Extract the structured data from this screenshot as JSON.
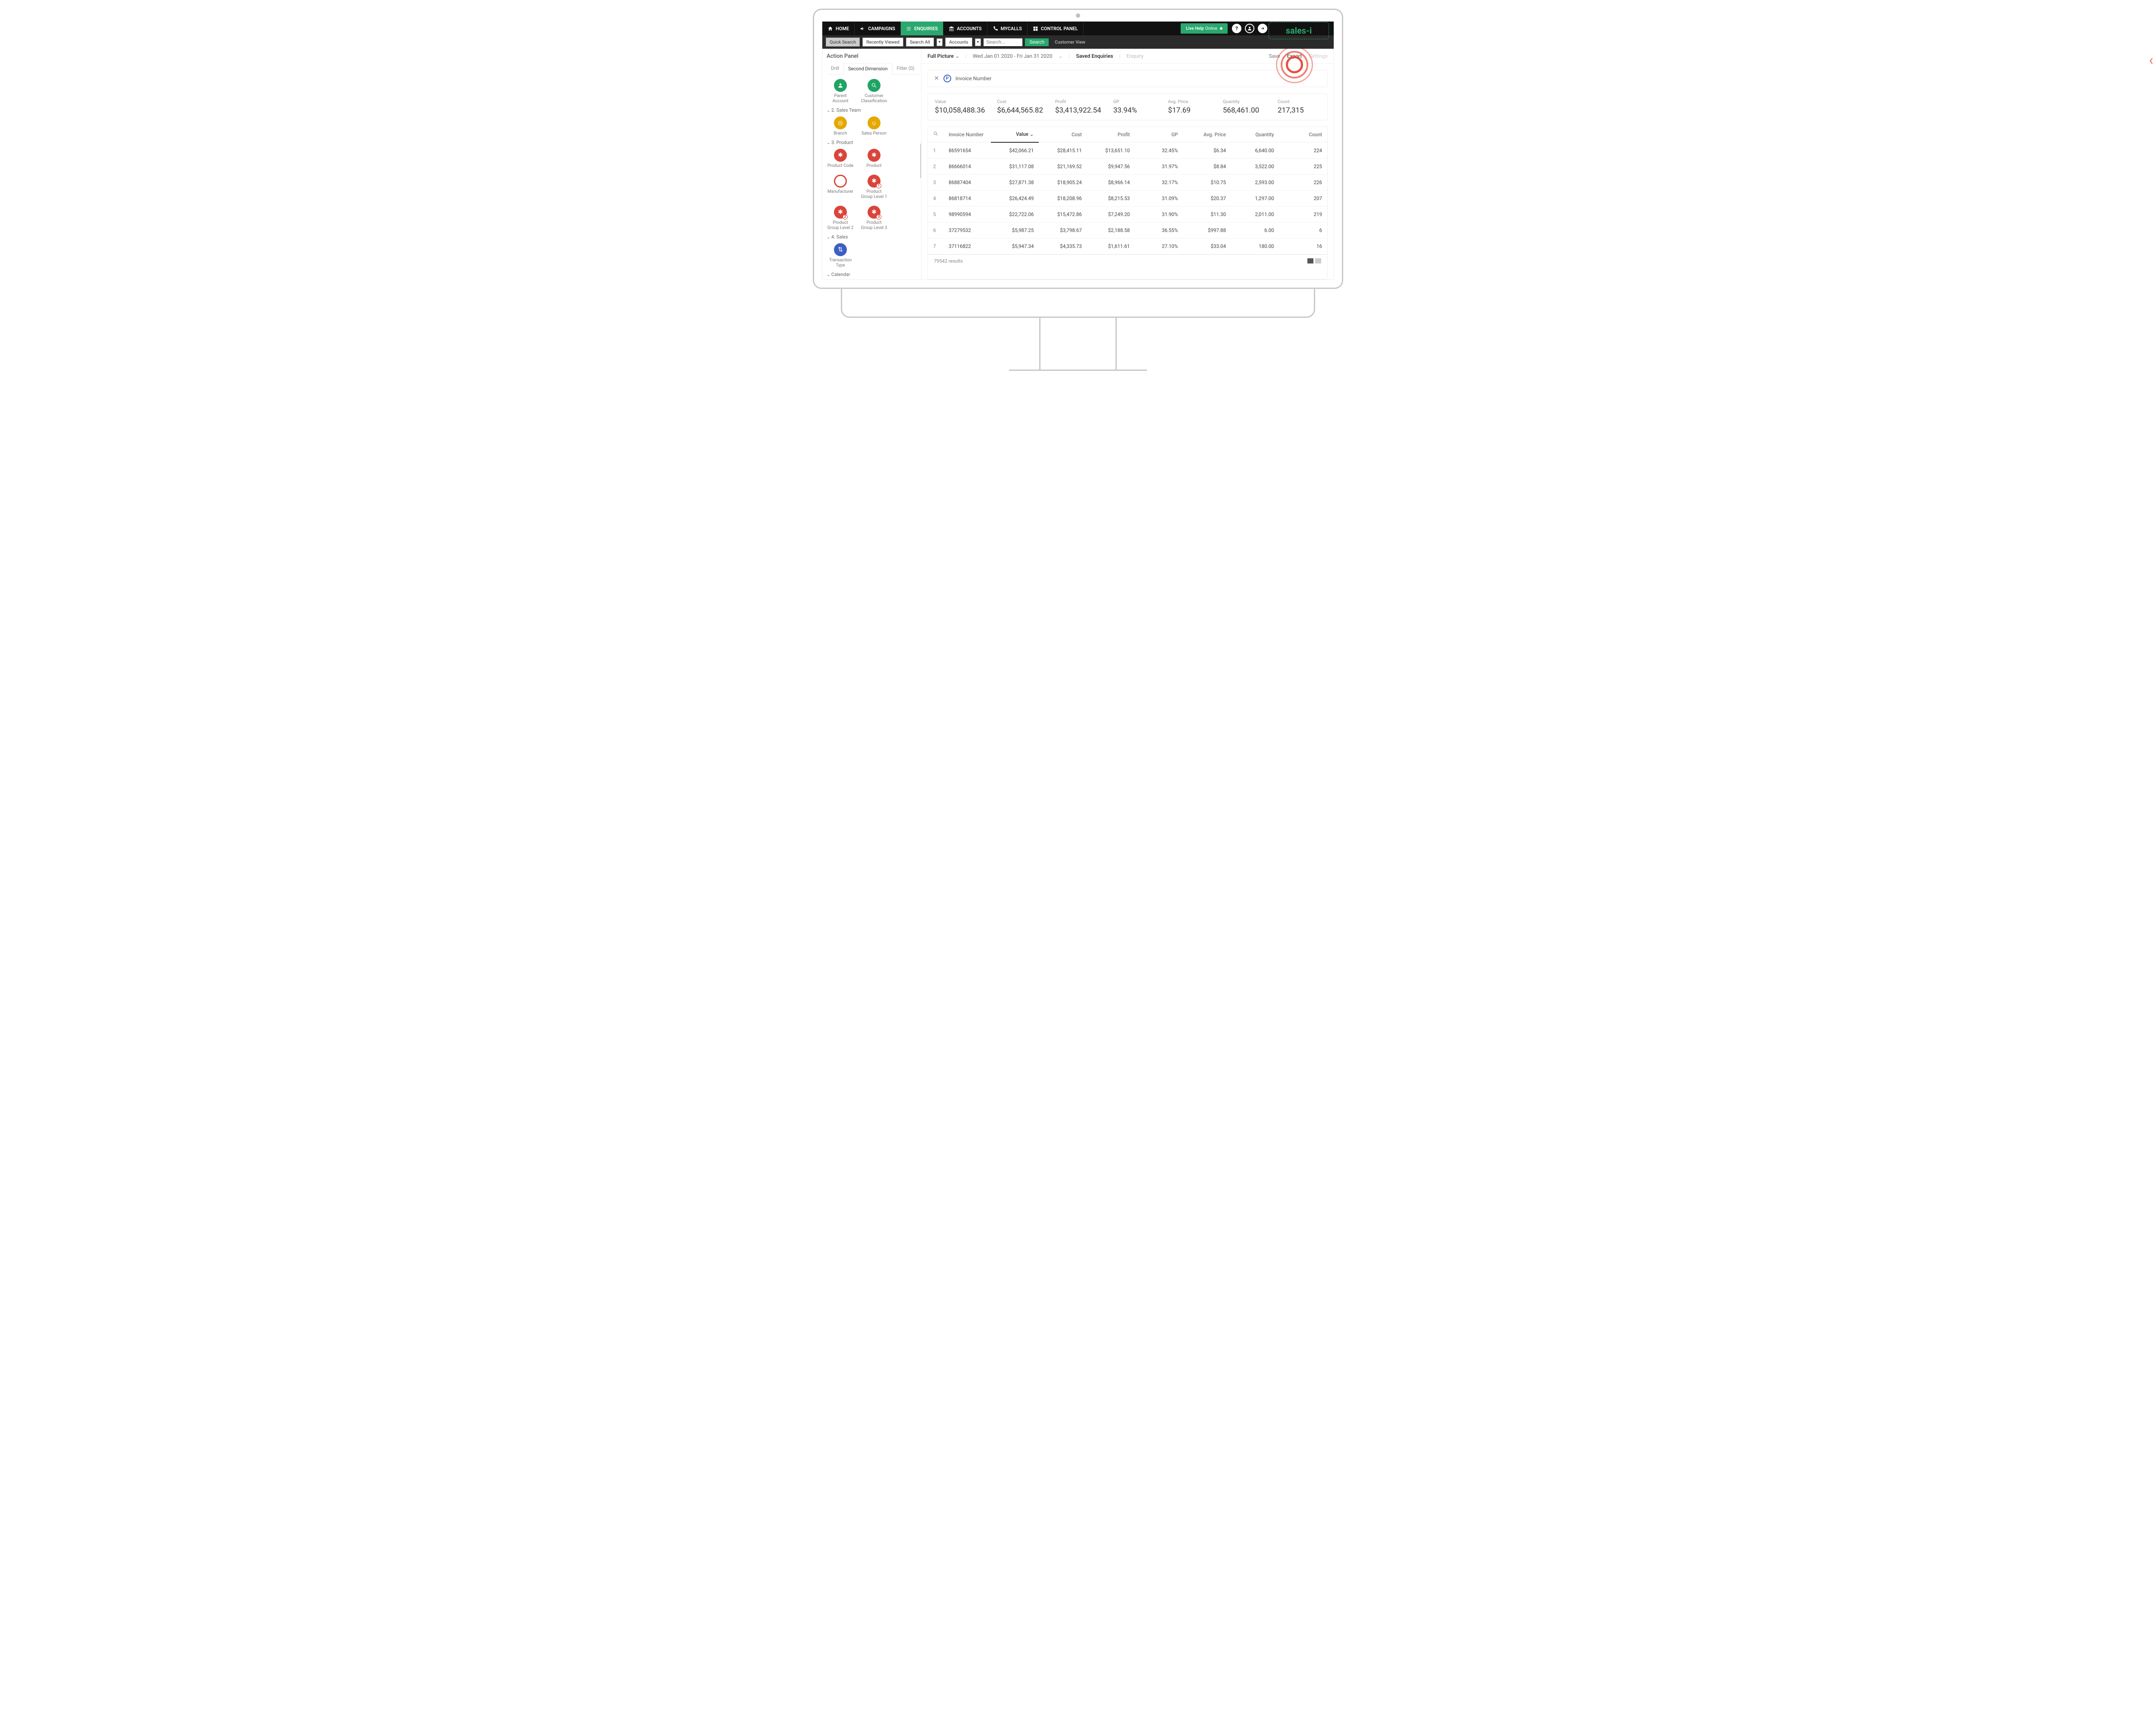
{
  "nav": {
    "home": "HOME",
    "campaigns": "CAMPAIGNS",
    "enquiries": "ENQUIRIES",
    "accounts": "ACCOUNTS",
    "mycalls": "MYCALLS",
    "control_panel": "CONTROL PANEL",
    "live_help": "Live Help",
    "online": "Online"
  },
  "logo": "sales-i",
  "search": {
    "quick": "Quick Search",
    "recent": "Recently Viewed",
    "search_all": "Search All",
    "accounts": "Accounts",
    "placeholder": "Search...",
    "go": "Search",
    "customer_view": "Customer View"
  },
  "sidebar": {
    "title": "Action Panel",
    "tabs": {
      "drill": "Drill",
      "second": "Second Dimension",
      "filter": "Filter (0)"
    },
    "top": {
      "parent_account": "Parent Account",
      "customer_class": "Customer Classification"
    },
    "g2": {
      "title": "2. Sales Team",
      "branch": "Branch",
      "sales_person": "Sales Person"
    },
    "g3": {
      "title": "3. Product",
      "product_code": "Product Code",
      "product": "Product",
      "manufacturer": "Manufacturer",
      "pg1": "Product Group Level 1",
      "pg2": "Product Group Level 2",
      "pg3": "Product Group Level 3"
    },
    "g4": {
      "title": "4. Sales",
      "transaction_type": "Transaction Type"
    },
    "g5": {
      "title": "Calendar"
    }
  },
  "crumbs": {
    "full_picture": "Full Picture",
    "date_range": "Wed Jan 01 2020 - Fri Jan 31 2020",
    "saved": "Saved Enquiries",
    "enquiry": "Enquiry",
    "save": "Save",
    "export": "Export",
    "settings": "Settings"
  },
  "chip": {
    "label": "Invoice Number"
  },
  "metrics": [
    {
      "k": "Value",
      "v": "$10,058,488.36"
    },
    {
      "k": "Cost",
      "v": "$6,644,565.82"
    },
    {
      "k": "Profit",
      "v": "$3,413,922.54"
    },
    {
      "k": "GP",
      "v": "33.94%"
    },
    {
      "k": "Avg. Price",
      "v": "$17.69"
    },
    {
      "k": "Quantity",
      "v": "568,461.00"
    },
    {
      "k": "Count",
      "v": "217,315"
    }
  ],
  "table": {
    "headers": {
      "invoice": "Invoice Number",
      "value": "Value",
      "cost": "Cost",
      "profit": "Profit",
      "gp": "GP",
      "avg": "Avg. Price",
      "qty": "Quantity",
      "count": "Count"
    },
    "rows": [
      {
        "n": "1",
        "inv": "86591654",
        "value": "$42,066.21",
        "cost": "$28,415.11",
        "profit": "$13,651.10",
        "gp": "32.45%",
        "avg": "$6.34",
        "qty": "6,640.00",
        "count": "224"
      },
      {
        "n": "2",
        "inv": "86666014",
        "value": "$31,117.08",
        "cost": "$21,169.52",
        "profit": "$9,947.56",
        "gp": "31.97%",
        "avg": "$8.84",
        "qty": "3,522.00",
        "count": "225"
      },
      {
        "n": "3",
        "inv": "86887404",
        "value": "$27,871.38",
        "cost": "$18,905.24",
        "profit": "$8,966.14",
        "gp": "32.17%",
        "avg": "$10.75",
        "qty": "2,593.00",
        "count": "226"
      },
      {
        "n": "4",
        "inv": "86818714",
        "value": "$26,424.49",
        "cost": "$18,208.96",
        "profit": "$8,215.53",
        "gp": "31.09%",
        "avg": "$20.37",
        "qty": "1,297.00",
        "count": "207"
      },
      {
        "n": "5",
        "inv": "98990594",
        "value": "$22,722.06",
        "cost": "$15,472.86",
        "profit": "$7,249.20",
        "gp": "31.90%",
        "avg": "$11.30",
        "qty": "2,011.00",
        "count": "219"
      },
      {
        "n": "6",
        "inv": "37279532",
        "value": "$5,987.25",
        "cost": "$3,798.67",
        "profit": "$2,188.58",
        "gp": "36.55%",
        "avg": "$997.88",
        "qty": "6.00",
        "count": "6"
      },
      {
        "n": "7",
        "inv": "37116822",
        "value": "$5,947.34",
        "cost": "$4,335.73",
        "profit": "$1,611.61",
        "gp": "27.10%",
        "avg": "$33.04",
        "qty": "180.00",
        "count": "16"
      }
    ],
    "results": "79542 results"
  }
}
